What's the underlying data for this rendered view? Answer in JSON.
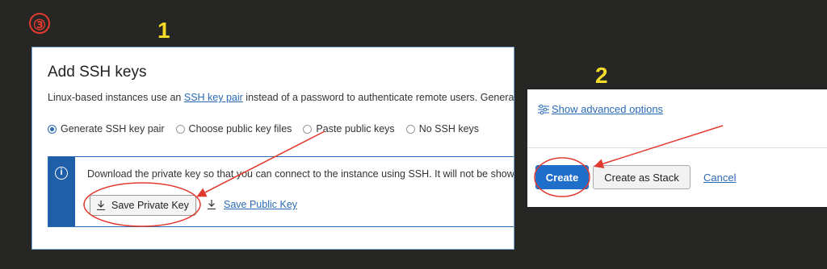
{
  "annotations": {
    "circled_step": "③",
    "step1": "1",
    "step2": "2",
    "highlight_color": "#e23a2e",
    "step_color": "#f5dc2a"
  },
  "ssh_panel": {
    "title": "Add SSH keys",
    "desc_prefix": "Linux-based instances use an ",
    "desc_link": "SSH key pair",
    "desc_suffix": " instead of a password to authenticate remote users. Generate",
    "radio_options": [
      {
        "label": "Generate SSH key pair",
        "checked": true
      },
      {
        "label": "Choose public key files",
        "checked": false
      },
      {
        "label": "Paste public keys",
        "checked": false
      },
      {
        "label": "No SSH keys",
        "checked": false
      }
    ],
    "info_icon": "info-icon",
    "info_text": "Download the private key so that you can connect to the instance using SSH. It will not be shown",
    "save_private_label": "Save Private Key",
    "save_public_label": "Save Public Key",
    "accent": "#1f5fa8"
  },
  "actions_panel": {
    "advanced_label": "Show advanced options",
    "create_label": "Create",
    "create_stack_label": "Create as Stack",
    "cancel_label": "Cancel",
    "primary": "#1f6ec9"
  }
}
